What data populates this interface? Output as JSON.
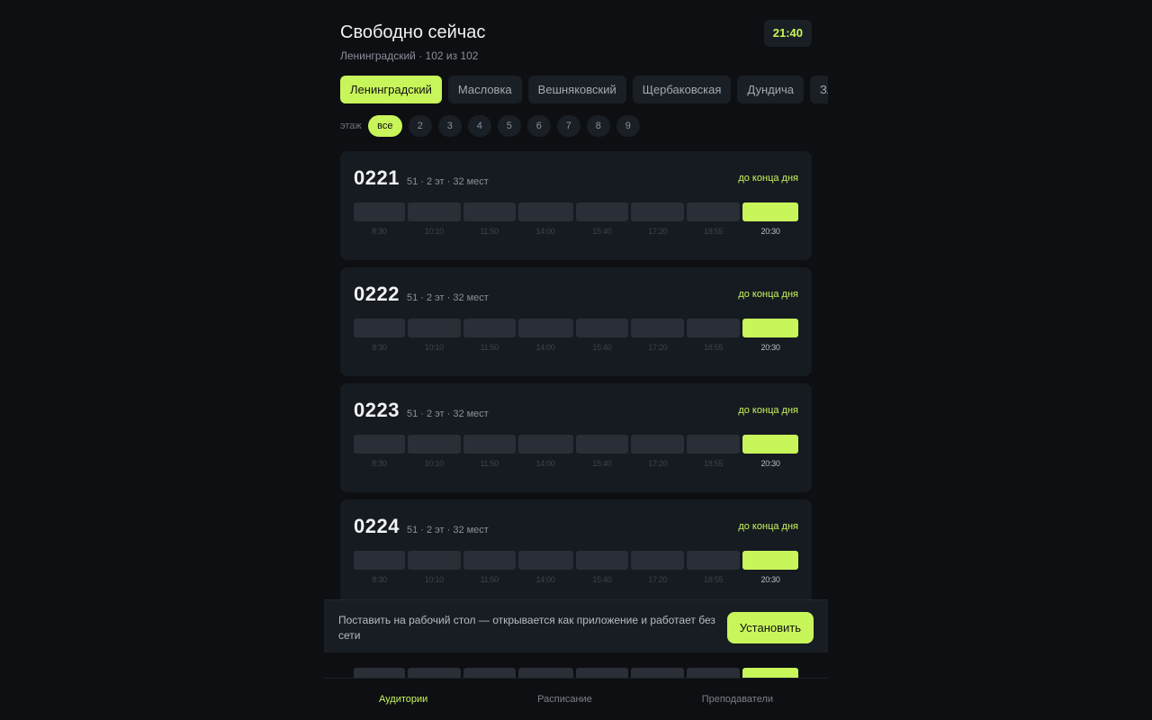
{
  "header": {
    "title": "Свободно сейчас",
    "subtitle": "Ленинградский · 102 из 102",
    "clock": "21:40"
  },
  "campus_tabs": [
    {
      "label": "Ленинградский",
      "active": true
    },
    {
      "label": "Масловка",
      "active": false
    },
    {
      "label": "Вешняковский",
      "active": false
    },
    {
      "label": "Щербаковская",
      "active": false
    },
    {
      "label": "Дундича",
      "active": false
    },
    {
      "label": "Зла",
      "active": false
    }
  ],
  "floors": {
    "label": "этаж",
    "items": [
      {
        "label": "все",
        "active": true
      },
      {
        "label": "2",
        "active": false
      },
      {
        "label": "3",
        "active": false
      },
      {
        "label": "4",
        "active": false
      },
      {
        "label": "5",
        "active": false
      },
      {
        "label": "6",
        "active": false
      },
      {
        "label": "7",
        "active": false
      },
      {
        "label": "8",
        "active": false
      },
      {
        "label": "9",
        "active": false
      }
    ]
  },
  "slot_times": [
    "8:30",
    "10:10",
    "11:50",
    "14:00",
    "15:40",
    "17:20",
    "18:55",
    "20:30"
  ],
  "rooms": [
    {
      "number": "0221",
      "meta": "51 · 2 эт · 32 мест",
      "until": "до конца дня",
      "free": [
        false,
        false,
        false,
        false,
        false,
        false,
        false,
        true
      ]
    },
    {
      "number": "0222",
      "meta": "51 · 2 эт · 32 мест",
      "until": "до конца дня",
      "free": [
        false,
        false,
        false,
        false,
        false,
        false,
        false,
        true
      ]
    },
    {
      "number": "0223",
      "meta": "51 · 2 эт · 32 мест",
      "until": "до конца дня",
      "free": [
        false,
        false,
        false,
        false,
        false,
        false,
        false,
        true
      ]
    },
    {
      "number": "0224",
      "meta": "51 · 2 эт · 32 мест",
      "until": "до конца дня",
      "free": [
        false,
        false,
        false,
        false,
        false,
        false,
        false,
        true
      ]
    }
  ],
  "install": {
    "text": "Поставить на рабочий стол — открывается как приложение и работает без сети",
    "button": "Установить"
  },
  "nav": [
    {
      "label": "Аудитории",
      "active": true
    },
    {
      "label": "Расписание",
      "active": false
    },
    {
      "label": "Преподаватели",
      "active": false
    }
  ],
  "colors": {
    "accent": "#c8f55a",
    "background": "#0d0f13",
    "card": "#161a21"
  }
}
